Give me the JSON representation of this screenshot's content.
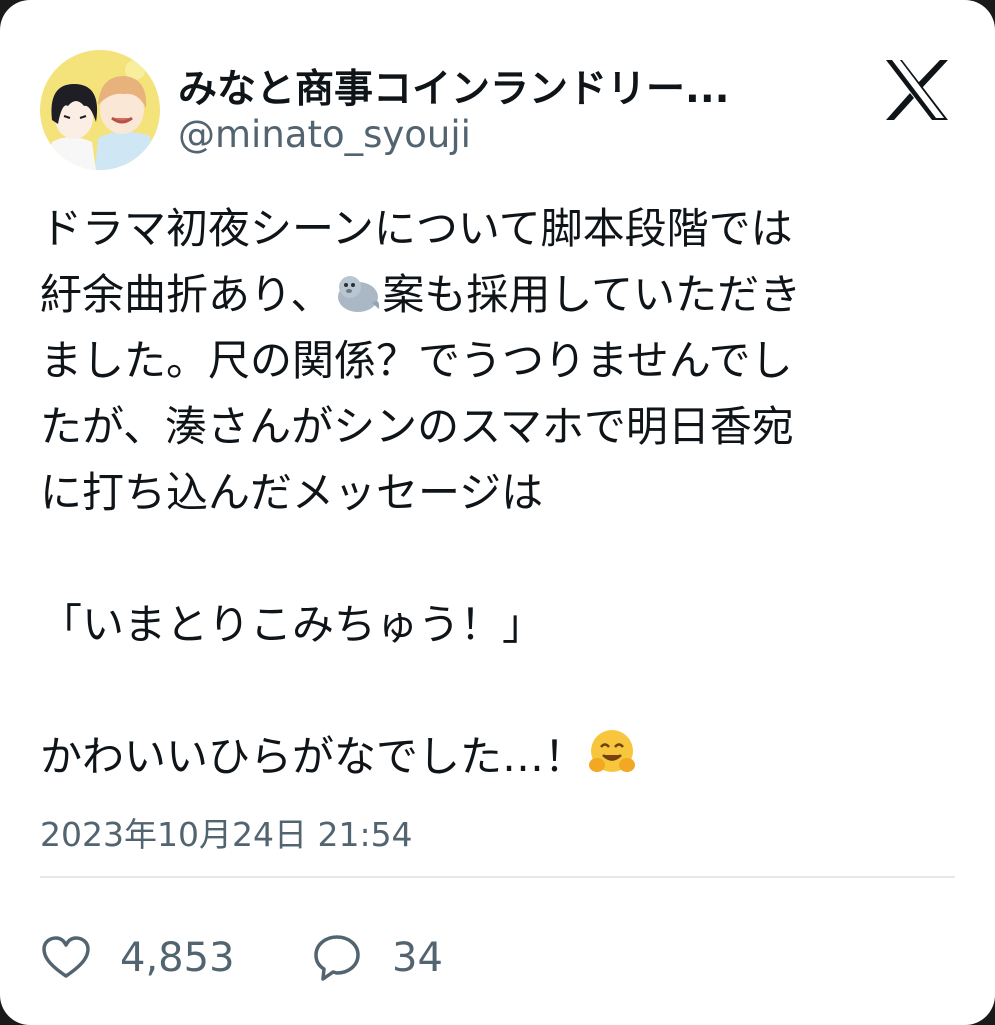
{
  "user": {
    "display_name": "みなと商事コインランドリー...",
    "handle": "@minato_syouji"
  },
  "tweet": {
    "line1": "ドラマ初夜シーンについて脚本段階では",
    "line2_pre": "紆余曲折あり、",
    "line2_post": "案も採用していただき",
    "line3": "ました。尺の関係？でうつりませんでし",
    "line4": "たが、湊さんがシンのスマホで明日香宛",
    "line5": "に打ち込んだメッセージは",
    "quote": "「いまとりこみちゅう！」",
    "closing": "かわいいひらがなでした…！",
    "emoji_seal": "seal-emoji",
    "emoji_hug": "hugging-face-emoji"
  },
  "timestamp": "2023年10月24日 21:54",
  "stats": {
    "likes": "4,853",
    "replies": "34"
  },
  "colors": {
    "text": "#0f1419",
    "secondary": "#536471",
    "divider": "#e4e8ea"
  },
  "icons": {
    "brand": "x-logo-icon",
    "like": "heart-icon",
    "reply": "speech-bubble-icon"
  }
}
